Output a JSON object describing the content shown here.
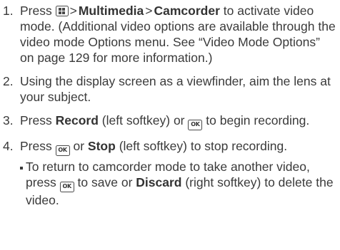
{
  "steps": [
    {
      "number": "1.",
      "press": "Press",
      "gt1": ">",
      "multimedia": "Multimedia",
      "gt2": ">",
      "camcorder": "Camcorder",
      "rest": "to activate video mode. (Additional video options are available through the video mode Options menu. See “Video Mode Options” on page 129 for more information.)",
      "menu_key_icon": "menu-key-icon"
    },
    {
      "number": "2.",
      "text": "Using the display screen as a viewfinder, aim the lens at your subject."
    },
    {
      "number": "3.",
      "press": "Press",
      "record": "Record",
      "middle": "(left softkey) or",
      "rest": "to begin recording.",
      "ok_key_label": "OK"
    },
    {
      "number": "4.",
      "press": "Press",
      "or": "or",
      "stop": "Stop",
      "rest": "(left softkey) to stop recording.",
      "ok_key_label": "OK",
      "sub": {
        "lead": "To return to camcorder mode to take another video, press",
        "middle": "to save or",
        "discard": "Discard",
        "rest": "(right softkey) to delete the video.",
        "ok_key_label": "OK"
      }
    }
  ]
}
